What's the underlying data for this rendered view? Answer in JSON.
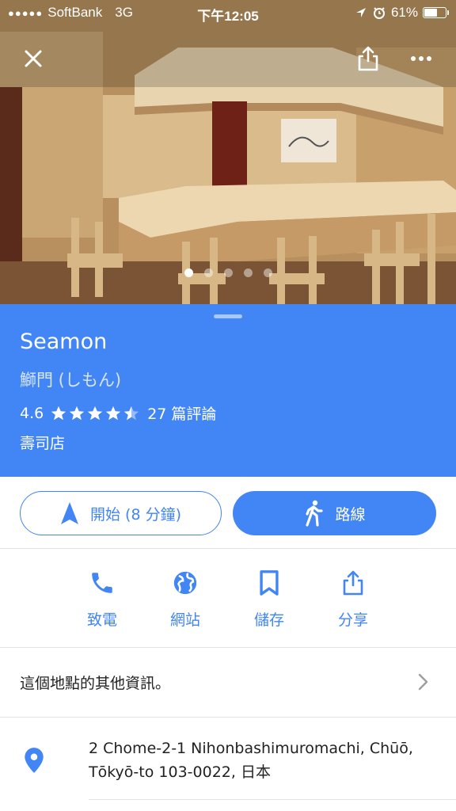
{
  "statusbar": {
    "carrier": "SoftBank",
    "network": "3G",
    "time": "下午12:05",
    "battery": "61%"
  },
  "photo": {
    "page_count": 5,
    "active_index": 0,
    "icons": [
      "close-icon",
      "share-icon",
      "more-icon"
    ]
  },
  "place": {
    "name": "Seamon",
    "subname": "鰤門 (しもん)",
    "rating": "4.6",
    "rating_value": 4.6,
    "reviews": "27 篇評論",
    "category": "壽司店"
  },
  "actions": {
    "start_label": "開始 (8 分鐘)",
    "route_label": "路線"
  },
  "quick_actions": [
    {
      "label": "致電",
      "icon": "phone-icon"
    },
    {
      "label": "網站",
      "icon": "globe-icon"
    },
    {
      "label": "儲存",
      "icon": "bookmark-icon"
    },
    {
      "label": "分享",
      "icon": "share-icon"
    }
  ],
  "more_info": "這個地點的其他資訊。",
  "address": {
    "line1": "2 Chome-2-1 Nihonbashimuromachi, Chūō,",
    "line2": "Tōkyō-to 103-0022, 日本"
  },
  "colors": {
    "accent": "#4285f4",
    "text": "#222222",
    "divider": "#e3e3e3"
  }
}
